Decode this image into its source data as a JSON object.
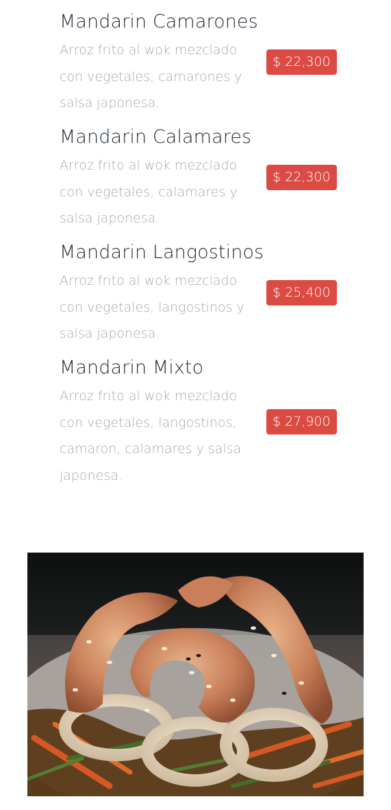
{
  "menu": {
    "items": [
      {
        "name": "Mandarin Camarones",
        "description": "Arroz frito al wok mezclado con vegetales, camarones y salsa japonesa.",
        "price": "$ 22,300"
      },
      {
        "name": "Mandarin Calamares",
        "description": "Arroz frito al wok mezclado con vegetales, calamares y salsa japonesa.",
        "price": "$ 22,300"
      },
      {
        "name": "Mandarin Langostinos",
        "description": "Arroz frito al wok mezclado con vegetales, langostinos y salsa japonesa.",
        "price": "$ 25,400"
      },
      {
        "name": "Mandarin Mixto",
        "description": "Arroz frito al wok mezclado con vegetales, langostinos, camaron, calamares y salsa japonesa.",
        "price": "$ 27,900"
      }
    ]
  },
  "colors": {
    "price_badge": "#dc4a44",
    "title_text": "#1f2a33",
    "description_text": "#a3a8ad"
  }
}
